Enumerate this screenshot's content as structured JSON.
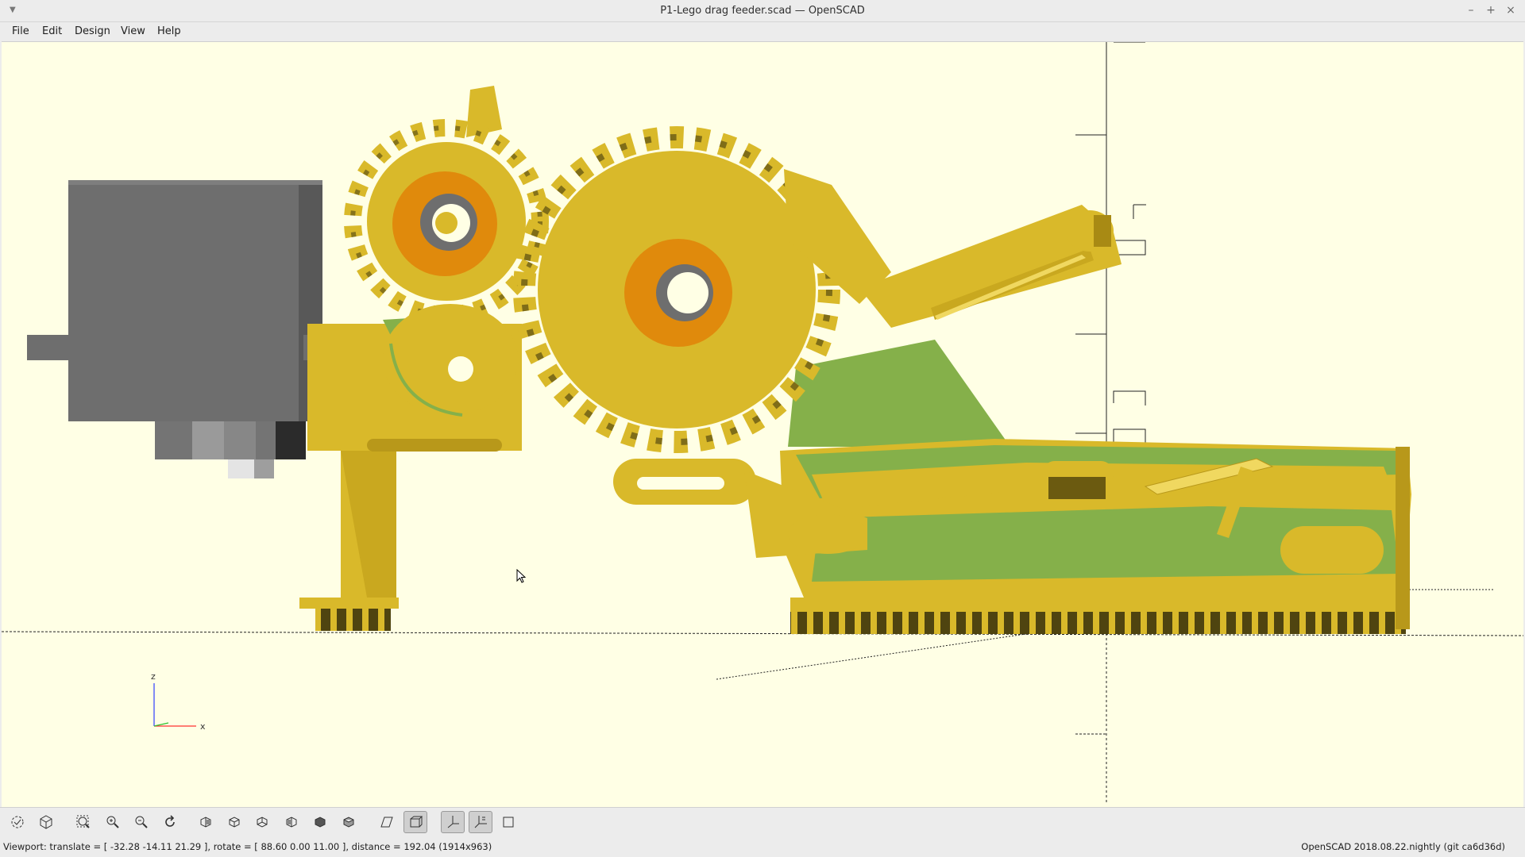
{
  "window": {
    "title": "P1-Lego drag feeder.scad — OpenSCAD",
    "controls": [
      "–",
      "+",
      "×"
    ]
  },
  "menu": [
    "File",
    "Edit",
    "Design",
    "View",
    "Help"
  ],
  "axes": {
    "z": "z",
    "x": "x"
  },
  "colors": {
    "background": "#ffffe5",
    "part_yellow": "#d9b92a",
    "part_dark": "#6b5a10",
    "part_green": "#85b04a",
    "part_orange": "#e08a0c",
    "servo_gray": "#6e6e6e"
  },
  "toolbar": [
    {
      "name": "preview-button",
      "icon": "preview-icon"
    },
    {
      "name": "render-button",
      "icon": "render-icon"
    },
    {
      "name": "view-all-button",
      "icon": "view-all-icon"
    },
    {
      "name": "zoom-in-button",
      "icon": "zoom-in-icon"
    },
    {
      "name": "zoom-out-button",
      "icon": "zoom-out-icon"
    },
    {
      "name": "reset-view-button",
      "icon": "reset-view-icon"
    },
    {
      "name": "view-right-button",
      "icon": "view-right-icon"
    },
    {
      "name": "view-top-button",
      "icon": "view-top-icon"
    },
    {
      "name": "view-bottom-button",
      "icon": "view-bottom-icon"
    },
    {
      "name": "view-left-button",
      "icon": "view-left-icon"
    },
    {
      "name": "view-front-button",
      "icon": "view-front-icon"
    },
    {
      "name": "view-back-button",
      "icon": "view-back-icon"
    },
    {
      "name": "perspective-button",
      "icon": "perspective-icon"
    },
    {
      "name": "orthogonal-button",
      "icon": "orthogonal-icon"
    },
    {
      "name": "show-axes-button",
      "icon": "axes-icon"
    },
    {
      "name": "show-scale-button",
      "icon": "scale-icon"
    },
    {
      "name": "show-edges-button",
      "icon": "edges-icon"
    }
  ],
  "status": {
    "viewport": "Viewport: translate = [ -32.28 -14.11 21.29 ], rotate = [ 88.60 0.00 11.00 ], distance = 192.04 (1914x963)",
    "version": "OpenSCAD 2018.08.22.nightly (git ca6d36d)"
  }
}
